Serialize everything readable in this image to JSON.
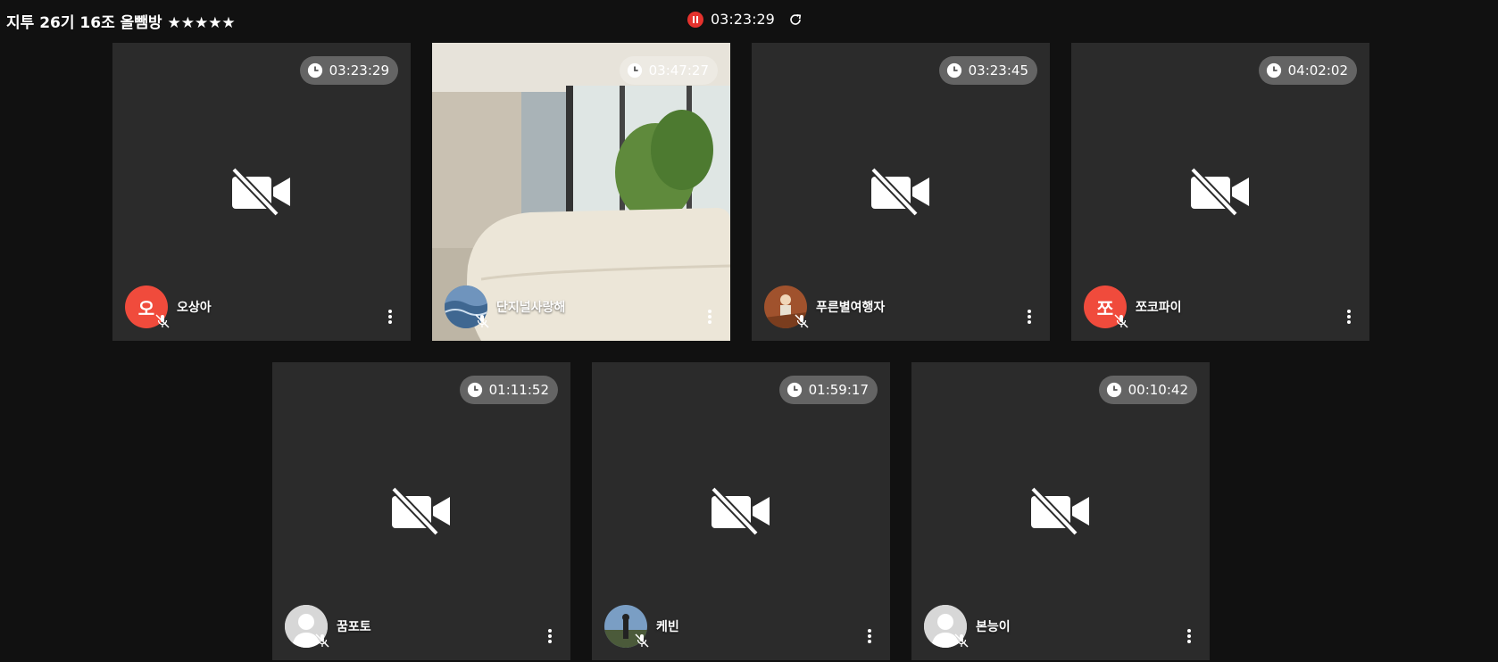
{
  "room": {
    "title": "지투 26기 16조 올뺌방 ★★★★★"
  },
  "recording": {
    "time": "03:23:29",
    "status_color": "#e5322d"
  },
  "participants": [
    {
      "name": "오상아",
      "timer": "03:23:29",
      "avatar_letter": "오",
      "avatar": "letter",
      "camera": "off",
      "mic": "off"
    },
    {
      "name": "단지널사랑해",
      "timer": "03:47:27",
      "avatar": "photo",
      "camera": "on",
      "mic": "off"
    },
    {
      "name": "푸른별여행자",
      "timer": "03:23:45",
      "avatar": "photo",
      "camera": "off",
      "mic": "off"
    },
    {
      "name": "쪼코파이",
      "timer": "04:02:02",
      "avatar_letter": "쪼",
      "avatar": "letter",
      "camera": "off",
      "mic": "off"
    },
    {
      "name": "꿈포토",
      "timer": "01:11:52",
      "avatar": "default",
      "camera": "off",
      "mic": "off"
    },
    {
      "name": "케빈",
      "timer": "01:59:17",
      "avatar": "photo",
      "camera": "off",
      "mic": "off"
    },
    {
      "name": "본능이",
      "timer": "00:10:42",
      "avatar": "default",
      "camera": "off",
      "mic": "off"
    }
  ],
  "colors": {
    "background": "#111111",
    "tile": "#2b2b2b",
    "avatar_red": "#f04b3c"
  }
}
